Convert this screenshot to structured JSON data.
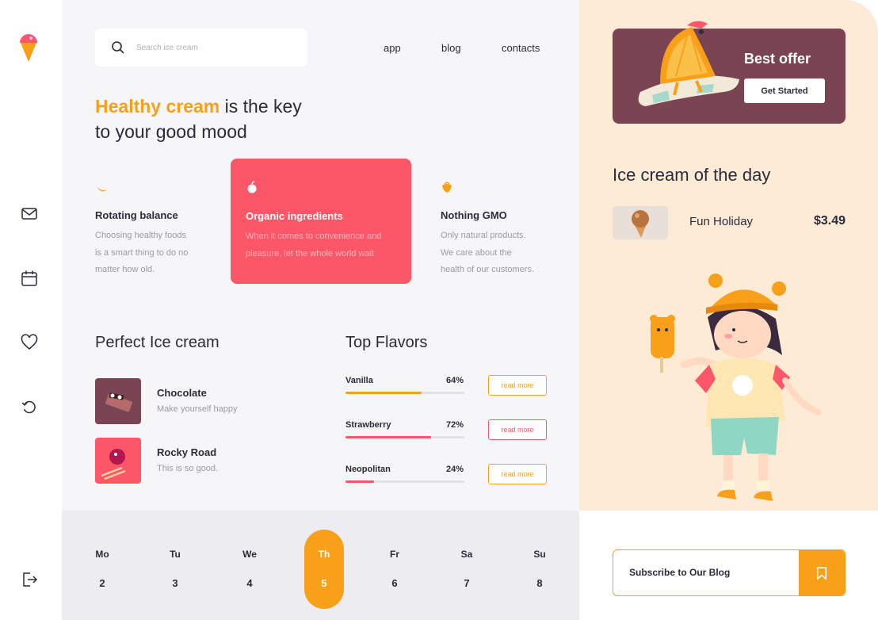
{
  "colors": {
    "accent": "#f9a01b",
    "pink": "#fc5769",
    "plum": "#7a4453",
    "peach": "#fdebd5"
  },
  "sidebar": {
    "logo": "ice-cream-logo",
    "icons": [
      "mail-icon",
      "calendar-icon",
      "heart-icon",
      "refresh-icon",
      "logout-icon"
    ]
  },
  "search": {
    "placeholder": "Search ice cream"
  },
  "nav": {
    "app": "app",
    "blog": "blog",
    "contacts": "contacts"
  },
  "hero": {
    "accent": "Healthy cream",
    "rest_line1": " is the key",
    "line2": "to your good mood"
  },
  "features": [
    {
      "icon": "moon-icon",
      "title": "Rotating balance",
      "desc_lines": [
        "Choosing healthy foods",
        "is a smart thing to do no",
        "matter how old."
      ]
    },
    {
      "icon": "apple-icon",
      "title": "Organic ingredients",
      "desc_lines": [
        "When it comes to convenience and",
        "pleasure, let the whole world wait"
      ]
    },
    {
      "icon": "strawberry-icon",
      "title": "Nothing GMO",
      "desc_lines": [
        "Only natural products.",
        "We care about the",
        "health of our customers."
      ]
    }
  ],
  "perfect": {
    "title": "Perfect Ice cream",
    "items": [
      {
        "name": "Chocolate",
        "desc": "Make yourself happy"
      },
      {
        "name": "Rocky Road",
        "desc": "This is so good."
      }
    ]
  },
  "flavors": {
    "title": "Top Flavors",
    "items": [
      {
        "name": "Vanilla",
        "percent_label": "64%",
        "percent": 0.64,
        "color": "#f9a01b",
        "button": "read more"
      },
      {
        "name": "Strawberry",
        "percent_label": "72%",
        "percent": 0.72,
        "color": "#fc5769",
        "button": "read more"
      },
      {
        "name": "Neopolitan",
        "percent_label": "24%",
        "percent": 0.24,
        "color": "#fc5769",
        "button": "read more"
      }
    ]
  },
  "calendar": {
    "days": [
      {
        "name": "Mo",
        "num": "2"
      },
      {
        "name": "Tu",
        "num": "3"
      },
      {
        "name": "We",
        "num": "4"
      },
      {
        "name": "Th",
        "num": "5",
        "active": true
      },
      {
        "name": "Fr",
        "num": "6"
      },
      {
        "name": "Sa",
        "num": "7"
      },
      {
        "name": "Su",
        "num": "8"
      }
    ]
  },
  "offer": {
    "title": "Best offer",
    "button": "Get Started"
  },
  "of_the_day": {
    "title": "Ice cream of the day",
    "name": "Fun Holiday",
    "price": "$3.49"
  },
  "subscribe": {
    "label": "Subscribe to Our Blog",
    "icon": "bookmark-icon"
  }
}
